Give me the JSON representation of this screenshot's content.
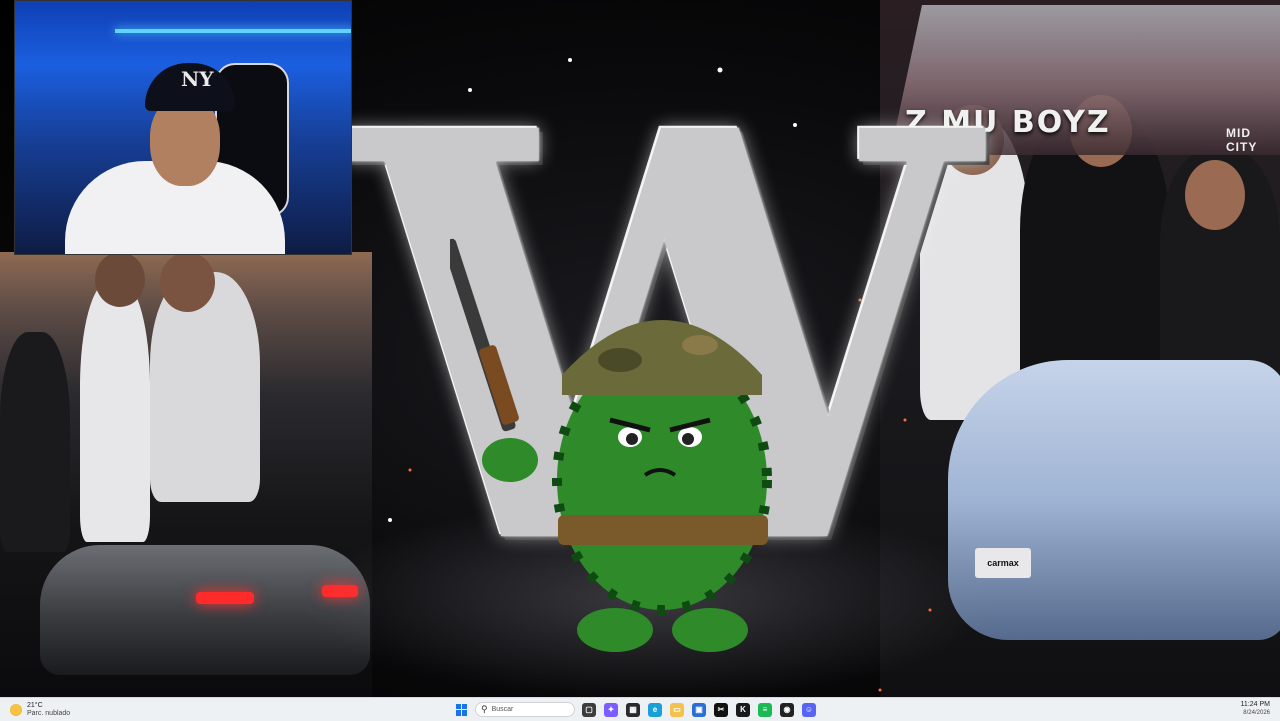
{
  "wallpaper": {
    "banner_text": "Z    MU    BOYZ",
    "banner_sub": "MID CITY",
    "plate_text": "carmax",
    "logo_letter": "W"
  },
  "webcam": {
    "cap_logo": "NY"
  },
  "taskbar": {
    "weather": {
      "temperature": "21°C",
      "condition": "Parc. nublado",
      "icon": "partly-cloudy-icon"
    },
    "search": {
      "placeholder": "Buscar"
    },
    "apps": [
      {
        "name": "task-view-icon",
        "color": "#3c3c3c",
        "glyph": "▢"
      },
      {
        "name": "copilot-icon",
        "color": "#7b5cff",
        "glyph": "✦"
      },
      {
        "name": "widgets-icon",
        "color": "#2a2a2a",
        "glyph": "▦"
      },
      {
        "name": "edge-icon",
        "color": "#1a9fd9",
        "glyph": "e"
      },
      {
        "name": "file-explorer-icon",
        "color": "#f2c14e",
        "glyph": "▭"
      },
      {
        "name": "store-icon",
        "color": "#2a6fd6",
        "glyph": "▣"
      },
      {
        "name": "capcut-icon",
        "color": "#111111",
        "glyph": "✂"
      },
      {
        "name": "kick-icon",
        "color": "#1a1a1a",
        "glyph": "K"
      },
      {
        "name": "spotify-icon",
        "color": "#1db954",
        "glyph": "≡"
      },
      {
        "name": "obs-icon",
        "color": "#222222",
        "glyph": "◉"
      },
      {
        "name": "discord-icon",
        "color": "#5865f2",
        "glyph": "☺"
      }
    ],
    "clock": {
      "time": "11:24 PM",
      "date": "8/24/2026"
    }
  }
}
